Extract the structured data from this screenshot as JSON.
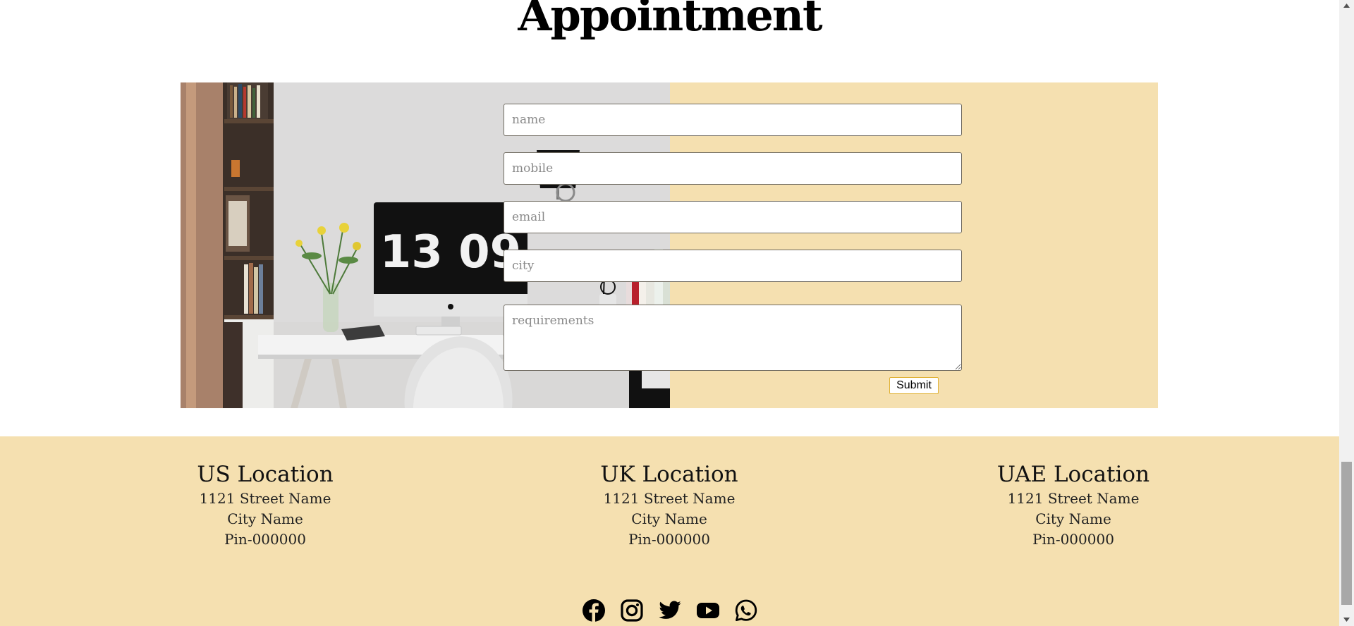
{
  "heading": "Appointment",
  "form": {
    "name_placeholder": "name",
    "mobile_placeholder": "mobile",
    "email_placeholder": "email",
    "city_placeholder": "city",
    "requirements_placeholder": "requirements",
    "submit_label": "Submit"
  },
  "photo": {
    "clock_text": "13 09"
  },
  "locations": [
    {
      "title": "US Location",
      "street": "1121 Street Name",
      "city": "City Name",
      "pin": "Pin-000000"
    },
    {
      "title": "UK Location",
      "street": "1121 Street Name",
      "city": "City Name",
      "pin": "Pin-000000"
    },
    {
      "title": "UAE Location",
      "street": "1121 Street Name",
      "city": "City Name",
      "pin": "Pin-000000"
    }
  ],
  "socials": [
    "facebook-icon",
    "instagram-icon",
    "twitter-icon",
    "youtube-icon",
    "whatsapp-icon"
  ],
  "colors": {
    "panel_bg": "#f5e0b0",
    "submit_border": "#e0b236",
    "icon": "#000000"
  }
}
